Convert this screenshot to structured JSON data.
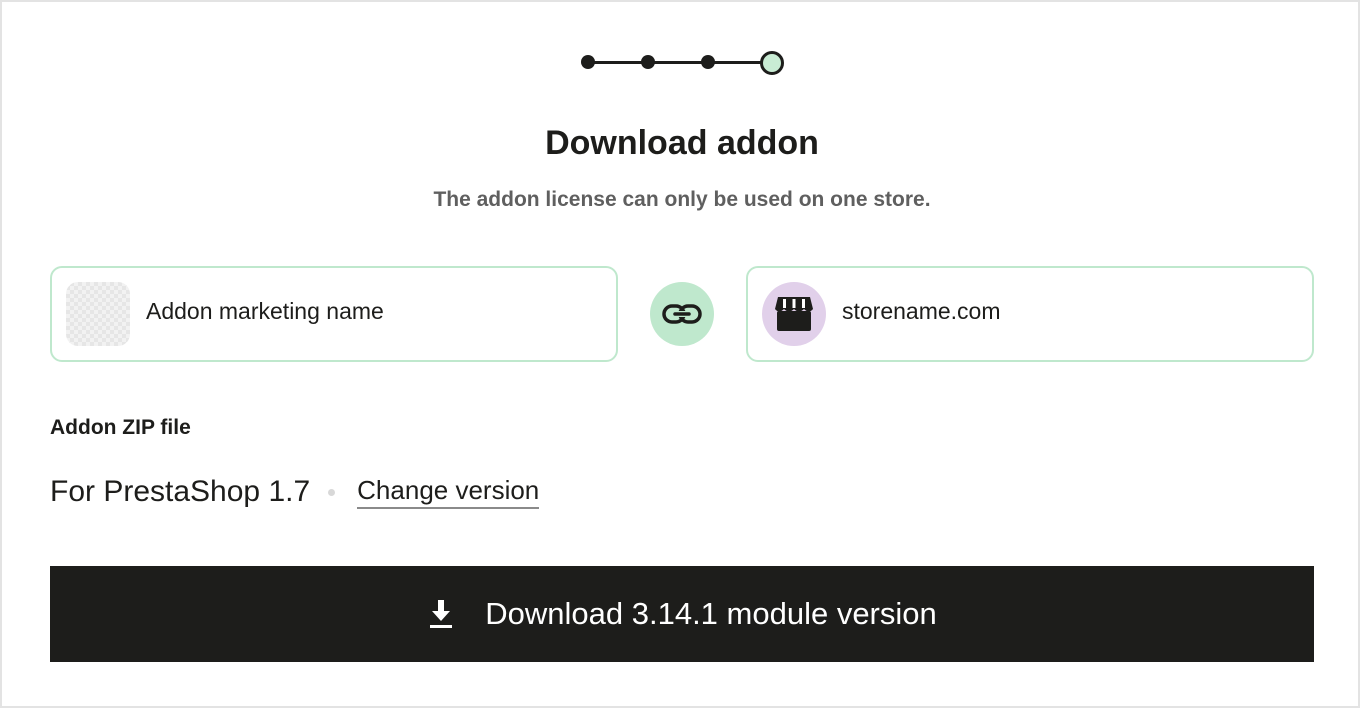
{
  "stepper": {
    "total_steps": 4,
    "current_step": 4,
    "active_color": "#c9ecd4"
  },
  "header": {
    "title": "Download addon",
    "subtitle": "The addon license can only be used on one store."
  },
  "addon_card": {
    "name": "Addon marketing name",
    "thumbnail_icon": "image-placeholder-icon"
  },
  "link": {
    "icon": "link-icon",
    "color": "#bfe8cd"
  },
  "store_card": {
    "name": "storename.com",
    "avatar_icon": "store-icon",
    "avatar_color": "#e1d0ea"
  },
  "zip_section": {
    "heading": "Addon ZIP file",
    "version_label": "For PrestaShop 1.7",
    "change_link": "Change version"
  },
  "download_button": {
    "label": "Download 3.14.1 module version",
    "icon": "download-icon",
    "background": "#1d1d1b"
  }
}
